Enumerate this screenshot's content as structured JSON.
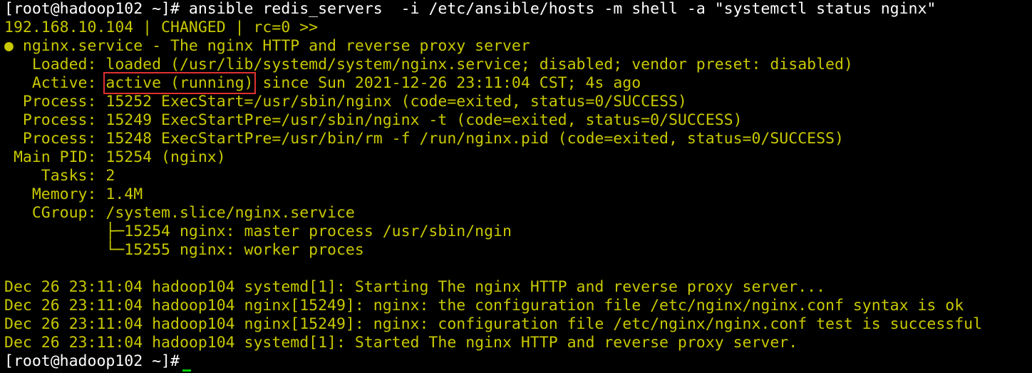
{
  "prompt_user": "[root@hadoop102 ~]#",
  "command": " ansible redis_servers  -i /etc/ansible/hosts -m shell -a \"systemctl status nginx\"",
  "result_header": "192.168.10.104 | CHANGED | rc=0 >>",
  "status": {
    "service_line": "● nginx.service - The nginx HTTP and reverse proxy server",
    "loaded": "   Loaded: loaded (/usr/lib/systemd/system/nginx.service; disabled; vendor preset: disabled)",
    "active_prefix": "   Active: ",
    "active_state": "active (running)",
    "active_suffix": " since Sun 2021-12-26 23:11:04 CST; 4s ago",
    "process_1": "  Process: 15252 ExecStart=/usr/sbin/nginx (code=exited, status=0/SUCCESS)",
    "process_2": "  Process: 15249 ExecStartPre=/usr/sbin/nginx -t (code=exited, status=0/SUCCESS)",
    "process_3": "  Process: 15248 ExecStartPre=/usr/bin/rm -f /run/nginx.pid (code=exited, status=0/SUCCESS)",
    "main_pid": " Main PID: 15254 (nginx)",
    "tasks": "    Tasks: 2",
    "memory": "   Memory: 1.4M",
    "cgroup": "   CGroup: /system.slice/nginx.service",
    "cgroup_child_1": "           ├─15254 nginx: master process /usr/sbin/ngin",
    "cgroup_child_2": "           └─15255 nginx: worker proces"
  },
  "logs": [
    "Dec 26 23:11:04 hadoop104 systemd[1]: Starting The nginx HTTP and reverse proxy server...",
    "Dec 26 23:11:04 hadoop104 nginx[15249]: nginx: the configuration file /etc/nginx/nginx.conf syntax is ok",
    "Dec 26 23:11:04 hadoop104 nginx[15249]: nginx: configuration file /etc/nginx/nginx.conf test is successful",
    "Dec 26 23:11:04 hadoop104 systemd[1]: Started The nginx HTTP and reverse proxy server."
  ],
  "final_prompt": "[root@hadoop102 ~]#",
  "colors": {
    "background": "#000000",
    "output_text": "#c8c800",
    "command_text": "#ffffff",
    "highlight_box": "#e03030",
    "cursor": "#00d000"
  }
}
